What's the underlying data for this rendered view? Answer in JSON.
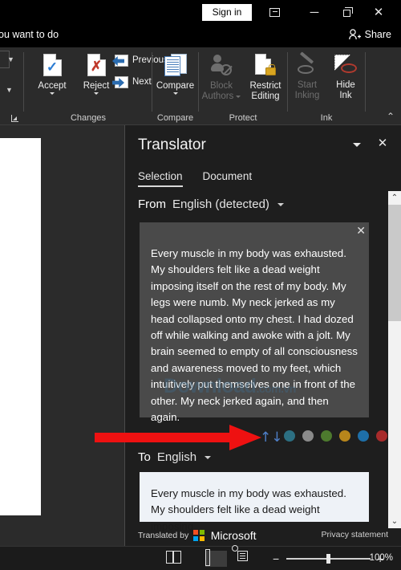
{
  "titlebar": {
    "signin_label": "Sign in",
    "ribbon_display_icon": "ribbon-display-options-icon",
    "minimize_icon": "minimize-icon",
    "restore_icon": "restore-icon",
    "close_icon": "close-icon",
    "close_glyph": "✕",
    "minimize_glyph": "─"
  },
  "searchrow": {
    "tellme_text": "ou want to do",
    "share_label": "Share"
  },
  "ribbon": {
    "groups": [
      {
        "name": "Changes",
        "label": "Changes",
        "buttons": [
          {
            "label": "Accept",
            "has_caret": true,
            "disabled": false,
            "icon": "accept-change-icon"
          },
          {
            "label": "Reject",
            "has_caret": true,
            "disabled": false,
            "icon": "reject-change-icon"
          },
          {
            "label": "Previous",
            "has_caret": false,
            "disabled": false,
            "icon": "previous-change-icon"
          },
          {
            "label": "Next",
            "has_caret": false,
            "disabled": false,
            "icon": "next-change-icon"
          }
        ]
      },
      {
        "name": "Compare",
        "label": "Compare",
        "buttons": [
          {
            "label": "Compare",
            "has_caret": true,
            "disabled": false,
            "icon": "compare-documents-icon"
          }
        ]
      },
      {
        "name": "Protect",
        "label": "Protect",
        "buttons": [
          {
            "label": "Block\nAuthors",
            "label_line1": "Block",
            "label_line2": "Authors",
            "has_caret": true,
            "disabled": true,
            "icon": "block-authors-icon"
          },
          {
            "label": "Restrict\nEditing",
            "label_line1": "Restrict",
            "label_line2": "Editing",
            "has_caret": false,
            "disabled": false,
            "icon": "restrict-editing-icon"
          }
        ]
      },
      {
        "name": "Ink",
        "label": "Ink",
        "buttons": [
          {
            "label": "Start\nInking",
            "label_line1": "Start",
            "label_line2": "Inking",
            "has_caret": false,
            "disabled": true,
            "icon": "start-inking-icon"
          },
          {
            "label": "Hide\nInk",
            "label_line1": "Hide",
            "label_line2": "Ink",
            "has_caret": false,
            "disabled": false,
            "icon": "hide-ink-icon"
          }
        ]
      }
    ],
    "collapse_glyph": "⌃"
  },
  "translator": {
    "title": "Translator",
    "collapse_icon": "chevron-down-icon",
    "close_icon": "close-icon",
    "close_glyph": "✕",
    "tabs": [
      {
        "label": "Selection",
        "active": true
      },
      {
        "label": "Document",
        "active": false
      }
    ],
    "from": {
      "label": "From",
      "language": "English (detected)",
      "caret_icon": "chevron-down-icon"
    },
    "to": {
      "label": "To",
      "language": "English",
      "caret_icon": "chevron-down-icon"
    },
    "source_text": "Every muscle in my body was exhausted. My shoulders felt like a dead weight imposing itself on the rest of my body. My legs were numb. My neck jerked as my head collapsed onto my chest. I had dozed off while walking and awoke with a jolt. My brain seemed to empty of all consciousness and awareness moved to my feet, which intuitively put themselves one in front of the other. My neck jerked again, and then again.",
    "source_clear_glyph": "✕",
    "target_text": "Every muscle in my body was exhausted. My shoulders felt like a dead weight imposing",
    "swap_icon": "swap-languages-icon",
    "swap_glyph": "↑↓",
    "swap_color": "#4f80c9",
    "dots": [
      {
        "name": "dot-teal",
        "color": "#2c6f82"
      },
      {
        "name": "dot-gray",
        "color": "#8a8a8a"
      },
      {
        "name": "dot-green",
        "color": "#4d7a2e"
      },
      {
        "name": "dot-amber",
        "color": "#b8861b"
      },
      {
        "name": "dot-blue",
        "color": "#1e6fa8"
      },
      {
        "name": "dot-red",
        "color": "#a82b2b"
      }
    ],
    "footer": {
      "translated_by": "Translated by",
      "brand": "Microsoft",
      "privacy": "Privacy statement",
      "ms_logo_colors": [
        "#f25022",
        "#7fba00",
        "#00a4ef",
        "#ffb900"
      ]
    },
    "scrollbar": {
      "up_glyph": "⌃",
      "down_glyph": "⌄"
    },
    "watermark": {
      "main": "Download",
      "suffix": ".com.vn"
    }
  },
  "statusbar": {
    "views": [
      {
        "name": "read-mode-view",
        "selected": false
      },
      {
        "name": "print-layout-view",
        "selected": true
      },
      {
        "name": "web-layout-view",
        "selected": false
      }
    ],
    "zoom_out_glyph": "−",
    "zoom_in_glyph": "+",
    "zoom_level": "100%"
  },
  "annotation": {
    "arrow_color": "#ee1111",
    "points_to": "swap-languages-icon"
  }
}
